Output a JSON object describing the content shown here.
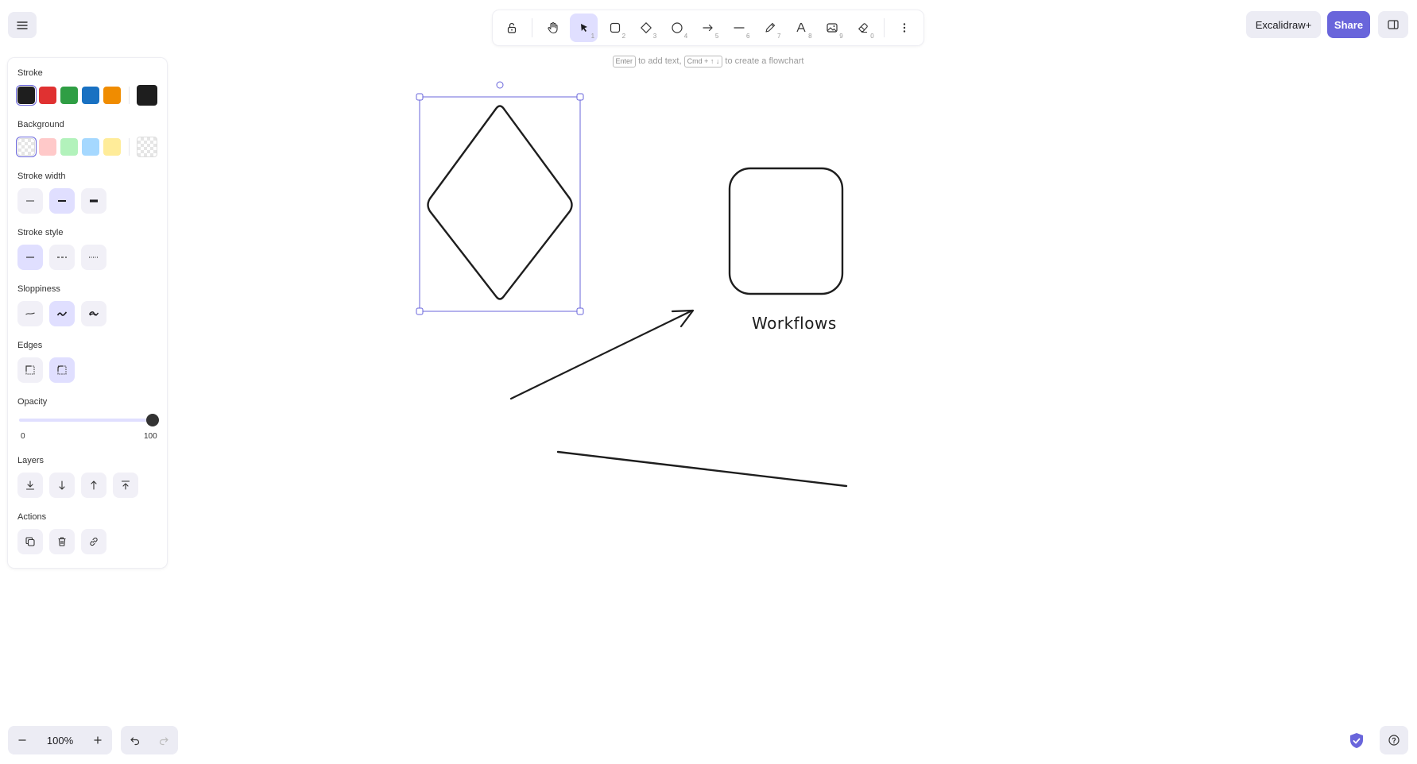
{
  "toolbar": {
    "tools": [
      {
        "name": "lock",
        "key": ""
      },
      {
        "name": "hand",
        "key": ""
      },
      {
        "name": "selection",
        "key": "1"
      },
      {
        "name": "rectangle",
        "key": "2"
      },
      {
        "name": "diamond",
        "key": "3"
      },
      {
        "name": "ellipse",
        "key": "4"
      },
      {
        "name": "arrow",
        "key": "5"
      },
      {
        "name": "line",
        "key": "6"
      },
      {
        "name": "draw",
        "key": "7"
      },
      {
        "name": "text",
        "key": "8"
      },
      {
        "name": "image",
        "key": "9"
      },
      {
        "name": "eraser",
        "key": "0"
      }
    ],
    "hint": {
      "enter_key": "Enter",
      "add_text": "to add text,",
      "flow_key": "Cmd + ↑ ↓",
      "flowchart": "to create a flowchart"
    }
  },
  "header": {
    "plus_label": "Excalidraw+",
    "share_label": "Share"
  },
  "panel": {
    "stroke_label": "Stroke",
    "background_label": "Background",
    "stroke_width_label": "Stroke width",
    "stroke_style_label": "Stroke style",
    "sloppiness_label": "Sloppiness",
    "edges_label": "Edges",
    "opacity_label": "Opacity",
    "opacity_min": "0",
    "opacity_max": "100",
    "opacity_value": 100,
    "layers_label": "Layers",
    "actions_label": "Actions",
    "stroke_colors": [
      "#1e1e1e",
      "#e03131",
      "#2f9e44",
      "#1971c2",
      "#f08c00"
    ],
    "stroke_current": "#1e1e1e",
    "background_colors": [
      "transparent",
      "#ffc9c9",
      "#b2f2bb",
      "#a5d8ff",
      "#ffec99"
    ],
    "background_current": "transparent"
  },
  "canvas": {
    "label_text": "Workflows"
  },
  "footer": {
    "zoom_value": "100%"
  },
  "colors": {
    "accent": "#6965db",
    "accent_light": "#e0dfff",
    "ink": "#1e1e1e"
  }
}
